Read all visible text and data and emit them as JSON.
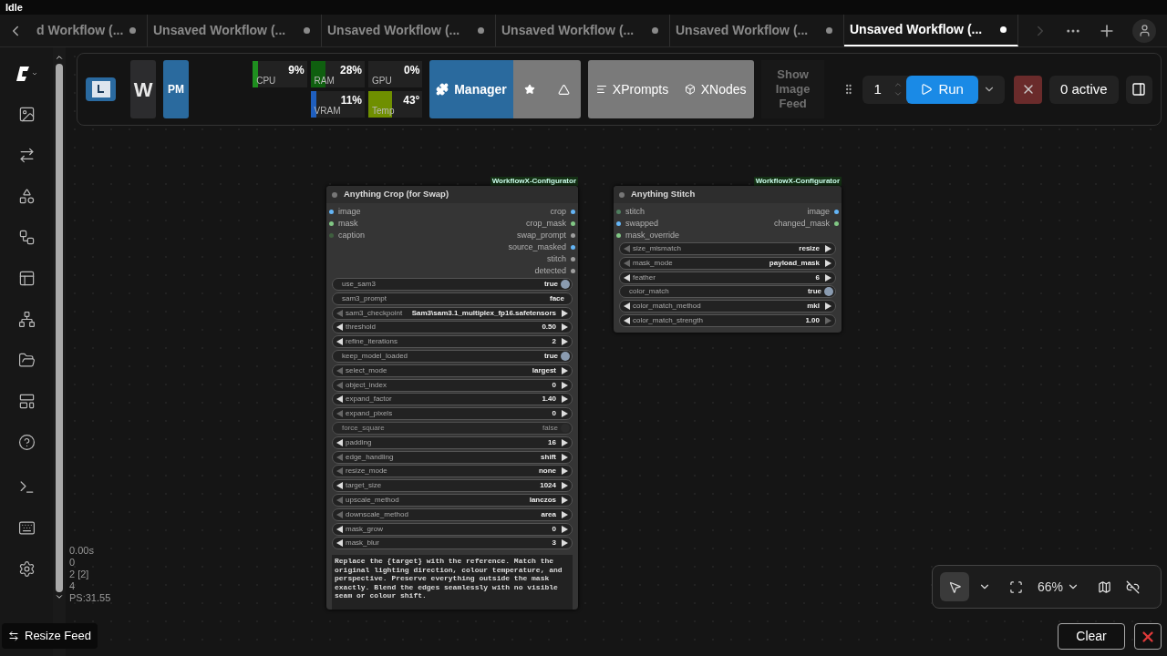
{
  "status": "Idle",
  "tabs": [
    {
      "label": "d Workflow (...",
      "selected": false
    },
    {
      "label": "Unsaved Workflow (...",
      "selected": false
    },
    {
      "label": "Unsaved Workflow (...",
      "selected": false
    },
    {
      "label": "Unsaved Workflow (...",
      "selected": false
    },
    {
      "label": "Unsaved Workflow (...",
      "selected": false
    },
    {
      "label": "Unsaved Workflow (...",
      "selected": true
    }
  ],
  "toolbar": {
    "badges": [
      "W",
      "PM"
    ],
    "monitors": [
      {
        "label": "CPU",
        "reading": "9%",
        "level": 0.09,
        "color": "#1f8f1f"
      },
      {
        "label": "RAM",
        "reading": "28%",
        "level": 0.28,
        "color": "#0f5f0f"
      },
      {
        "label": "GPU",
        "reading": "0%"
      },
      {
        "label": "VRAM",
        "reading": "11%",
        "level": 0.11,
        "color": "#1f5fbf"
      },
      {
        "label": "Temp",
        "reading": "43°",
        "level": 0.43,
        "color": "#6f8f00"
      }
    ],
    "manager": "Manager",
    "extensions": [
      "XPrompts",
      "XNodes"
    ],
    "feed_button": {
      "label": "Show Image Feed",
      "disabled": true
    },
    "queue": {
      "count": "1",
      "run": "Run",
      "active": "0 active"
    }
  },
  "nodes": [
    {
      "badge": "WorkflowX-Configurator",
      "title": "Anything Crop (for Swap)",
      "inputs": [
        {
          "name": "image",
          "color": "#64b5f6"
        },
        {
          "name": "mask",
          "color": "#81c784"
        },
        {
          "name": "caption",
          "color": "#3f5f3f"
        }
      ],
      "outputs": [
        {
          "name": "crop",
          "color": "#64b5f6"
        },
        {
          "name": "crop_mask",
          "color": "#81c784"
        },
        {
          "name": "swap_prompt",
          "color": "#9e9e9e"
        },
        {
          "name": "source_masked",
          "color": "#64b5f6"
        },
        {
          "name": "stitch",
          "color": "#9e9e9e"
        },
        {
          "name": "detected",
          "color": "#9e9e9e"
        }
      ],
      "widgets": [
        {
          "kind": "toggle",
          "name": "use_sam3",
          "value": "true",
          "on": true
        },
        {
          "kind": "text",
          "name": "sam3_prompt",
          "value": "face"
        },
        {
          "kind": "combo",
          "name": "sam3_checkpoint",
          "value": "Sam3\\sam3.1_multiplex_fp16.safetensors",
          "at_min": true,
          "at_max": false
        },
        {
          "kind": "combo",
          "name": "threshold",
          "value": "0.50",
          "at_min": false,
          "at_max": false
        },
        {
          "kind": "combo",
          "name": "refine_iterations",
          "value": "2",
          "at_min": false,
          "at_max": false
        },
        {
          "kind": "toggle",
          "name": "keep_model_loaded",
          "value": "true",
          "on": true
        },
        {
          "kind": "combo",
          "name": "select_mode",
          "value": "largest",
          "at_min": true,
          "at_max": false
        },
        {
          "kind": "combo",
          "name": "object_index",
          "value": "0",
          "at_min": true,
          "at_max": false
        },
        {
          "kind": "combo",
          "name": "expand_factor",
          "value": "1.40",
          "at_min": false,
          "at_max": false
        },
        {
          "kind": "combo",
          "name": "expand_pixels",
          "value": "0",
          "at_min": true,
          "at_max": false
        },
        {
          "kind": "toggle",
          "name": "force_square",
          "value": "false",
          "on": false
        },
        {
          "kind": "combo",
          "name": "padding",
          "value": "16",
          "at_min": false,
          "at_max": false
        },
        {
          "kind": "combo",
          "name": "edge_handling",
          "value": "shift",
          "at_min": true,
          "at_max": false
        },
        {
          "kind": "combo",
          "name": "resize_mode",
          "value": "none",
          "at_min": true,
          "at_max": false
        },
        {
          "kind": "combo",
          "name": "target_size",
          "value": "1024",
          "at_min": false,
          "at_max": false
        },
        {
          "kind": "combo",
          "name": "upscale_method",
          "value": "lanczos",
          "at_min": true,
          "at_max": false
        },
        {
          "kind": "combo",
          "name": "downscale_method",
          "value": "area",
          "at_min": true,
          "at_max": false
        },
        {
          "kind": "combo",
          "name": "mask_grow",
          "value": "0",
          "at_min": false,
          "at_max": false
        },
        {
          "kind": "combo",
          "name": "mask_blur",
          "value": "3",
          "at_min": false,
          "at_max": false
        }
      ],
      "prompt": "Replace the {target} with the reference. Match the original lighting direction, colour temperature, and perspective. Preserve everything outside the mask exactly. Blend the edges seamlessly with no visible seam or colour shift."
    },
    {
      "badge": "WorkflowX-Configurator",
      "title": "Anything Stitch",
      "inputs": [
        {
          "name": "stitch",
          "color": "#4f7f5f"
        },
        {
          "name": "swapped",
          "color": "#64b5f6"
        },
        {
          "name": "mask_override",
          "color": "#81c784"
        }
      ],
      "outputs": [
        {
          "name": "image",
          "color": "#64b5f6"
        },
        {
          "name": "changed_mask",
          "color": "#81c784"
        }
      ],
      "widgets": [
        {
          "kind": "combo",
          "name": "size_mismatch",
          "value": "resize",
          "at_min": true,
          "at_max": false
        },
        {
          "kind": "combo",
          "name": "mask_mode",
          "value": "payload_mask",
          "at_min": true,
          "at_max": false
        },
        {
          "kind": "combo",
          "name": "feather",
          "value": "6",
          "at_min": false,
          "at_max": false
        },
        {
          "kind": "toggle",
          "name": "color_match",
          "value": "true",
          "on": true
        },
        {
          "kind": "combo",
          "name": "color_match_method",
          "value": "mkl",
          "at_min": false,
          "at_max": false
        },
        {
          "kind": "combo",
          "name": "color_match_strength",
          "value": "1.00",
          "at_min": false,
          "at_max": true
        }
      ]
    }
  ],
  "stats": [
    "0.00s",
    "0",
    "2 [2]",
    "4",
    "PS:31.55"
  ],
  "canvas_controls": {
    "pointer_selected": true,
    "zoom": "66%"
  },
  "resize_feed": "Resize Feed",
  "clear": "Clear"
}
